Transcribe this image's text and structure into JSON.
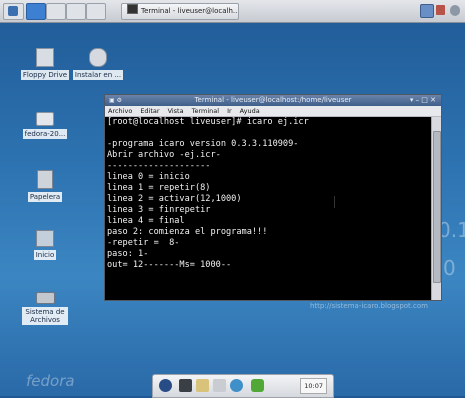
{
  "taskbar": {
    "task_title": "Terminal - liveuser@localh..."
  },
  "desktop_icons": [
    {
      "label": "Floppy Drive"
    },
    {
      "label": "Instalar en ..."
    },
    {
      "label": "fedora-20..."
    },
    {
      "label": "Papelera"
    },
    {
      "label": "Inicio"
    },
    {
      "label": "Sistema de Archivos"
    }
  ],
  "terminal": {
    "title": "Terminal - liveuser@localhost:/home/liveuser",
    "title_icon_glyph": "▣ ⚙",
    "window_controls": "▾  –  □  ✕",
    "menu": [
      "Archivo",
      "Editar",
      "Vista",
      "Terminal",
      "Ir",
      "Ayuda"
    ],
    "lines": [
      "[root@localhost liveuser]# icaro ej.icr",
      "",
      "-programa icaro version 0.3.3.110909-",
      "Abrir archivo -ej.icr-",
      "--------------------",
      "linea 0 = inicio",
      "linea 1 = repetir(8)",
      "linea 2 = activar(12,1000)",
      "linea 3 = finrepetir",
      "linea 4 = final",
      "paso 2: comienza el programa!!!",
      "-repetir =  8-",
      "paso: 1-",
      "out= 12-------Ms= 1000--"
    ]
  },
  "background_text": {
    "url": "http://sistema-icaro.blogspot.com",
    "big_digits": [
      "0.1",
      "0"
    ],
    "brand": "fedora"
  },
  "dock": {
    "clock": "10:07"
  },
  "colors": {
    "desktop": "#2d72b0",
    "terminal_bg": "#000000",
    "titlebar": "#4f6e98"
  }
}
